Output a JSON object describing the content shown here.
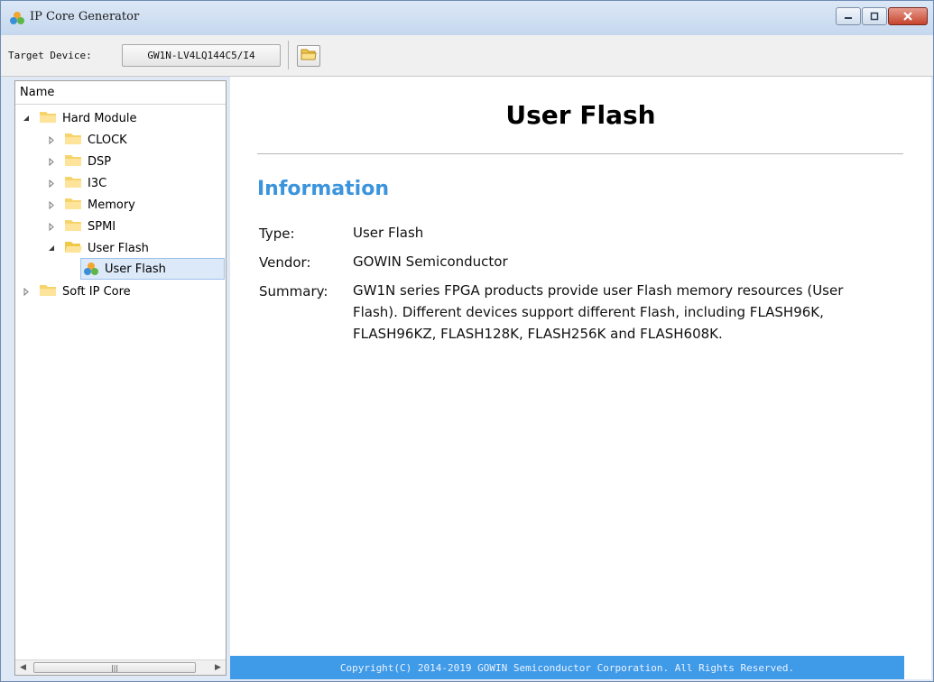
{
  "window": {
    "title": "IP Core Generator",
    "accent": "#3f9ae8"
  },
  "toolbar": {
    "target_label": "Target Device:",
    "device_value": "GW1N-LV4LQ144C5/I4",
    "folder_icon": "folder-open-icon"
  },
  "tree": {
    "header": "Name",
    "items": [
      {
        "label": "Hard Module",
        "expanded": true
      },
      {
        "label": "CLOCK"
      },
      {
        "label": "DSP"
      },
      {
        "label": "I3C"
      },
      {
        "label": "Memory"
      },
      {
        "label": "SPMI"
      },
      {
        "label": "User Flash",
        "expanded": true
      },
      {
        "label": "User Flash",
        "selected": true
      },
      {
        "label": "Soft IP Core"
      }
    ]
  },
  "doc": {
    "title": "User Flash",
    "section": "Information",
    "type_key": "Type:",
    "type_val": "User Flash",
    "vendor_key": "Vendor:",
    "vendor_val": "GOWIN Semiconductor",
    "summary_key": "Summary:",
    "summary_val": "GW1N series FPGA products provide user Flash memory resources (User Flash). Different devices support different Flash, including FLASH96K, FLASH96KZ, FLASH128K, FLASH256K and FLASH608K.",
    "footer": "Copyright(C) 2014-2019 GOWIN Semiconductor Corporation. All Rights Reserved."
  }
}
